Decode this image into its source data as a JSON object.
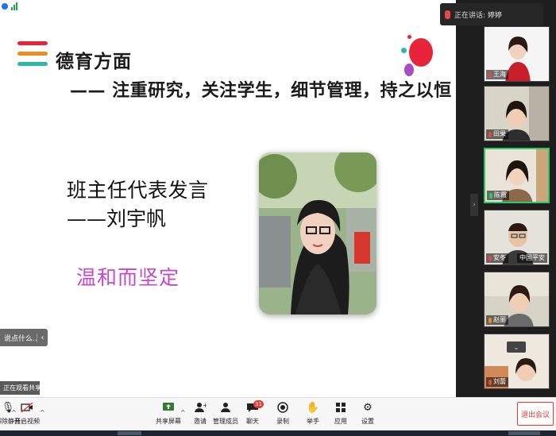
{
  "slide": {
    "title": "德育方面",
    "subtitle": "—— 注重研究，关注学生，细节管理，持之以恒",
    "speaker_role": "班主任代表发言",
    "speaker_name": "——刘宇帆",
    "quality": "温和而坚定",
    "stripe_colors": [
      "#e8243b",
      "#f08c1e",
      "#2bb8a5"
    ]
  },
  "side": {
    "chat_pill": "说点什么...",
    "share_pill": "正在观看共享"
  },
  "panel": {
    "header_name": "正在讲话: 婷婷",
    "tiles": [
      {
        "name": "王海"
      },
      {
        "name": "田果"
      },
      {
        "name": "陈霞"
      },
      {
        "name": "安冬",
        "tag": "中国平安"
      },
      {
        "name": "赵丽"
      },
      {
        "name": "刘蕾"
      }
    ]
  },
  "toolbar": {
    "items": [
      {
        "label": "解除静音",
        "icon": "mic-icon"
      },
      {
        "label": "开启视频",
        "icon": "video-icon"
      },
      {
        "label": "共享屏幕",
        "icon": "share-screen-icon"
      },
      {
        "label": "邀请",
        "icon": "invite-icon"
      },
      {
        "label": "管理成员",
        "icon": "members-icon"
      },
      {
        "label": "聊天",
        "icon": "chat-icon"
      },
      {
        "label": "录制",
        "icon": "record-icon"
      },
      {
        "label": "举手",
        "icon": "raise-hand-icon"
      },
      {
        "label": "应用",
        "icon": "apps-icon"
      },
      {
        "label": "设置",
        "icon": "settings-icon"
      }
    ],
    "chat_badge": "31",
    "end_label": "退出会议"
  }
}
